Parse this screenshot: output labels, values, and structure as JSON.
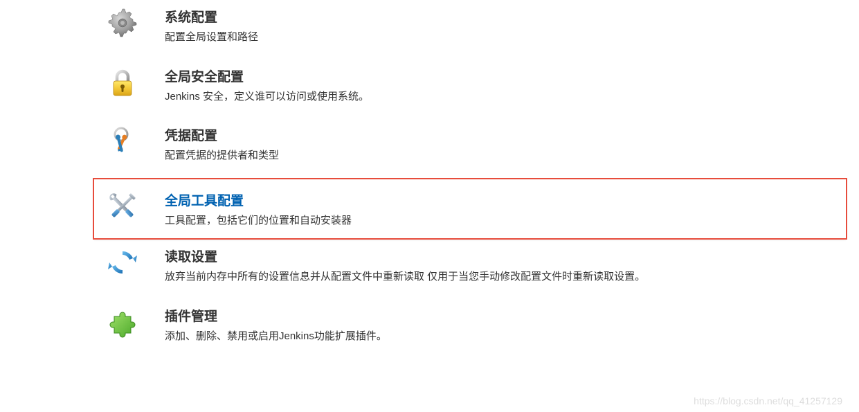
{
  "items": [
    {
      "key": "system-config",
      "title": "系统配置",
      "desc": "配置全局设置和路径",
      "icon": "gear"
    },
    {
      "key": "security-config",
      "title": "全局安全配置",
      "desc": "Jenkins 安全，定义谁可以访问或使用系统。",
      "icon": "lock"
    },
    {
      "key": "credentials-config",
      "title": "凭据配置",
      "desc": "配置凭据的提供者和类型",
      "icon": "keys"
    },
    {
      "key": "global-tools-config",
      "title": "全局工具配置",
      "desc": "工具配置，包括它们的位置和自动安装器",
      "icon": "tools",
      "highlighted": true
    },
    {
      "key": "reload-config",
      "title": "读取设置",
      "desc": "放弃当前内存中所有的设置信息并从配置文件中重新读取 仅用于当您手动修改配置文件时重新读取设置。",
      "icon": "reload"
    },
    {
      "key": "plugin-manager",
      "title": "插件管理",
      "desc": "添加、删除、禁用或启用Jenkins功能扩展插件。",
      "icon": "puzzle"
    }
  ],
  "watermark": "https://blog.csdn.net/qq_41257129"
}
